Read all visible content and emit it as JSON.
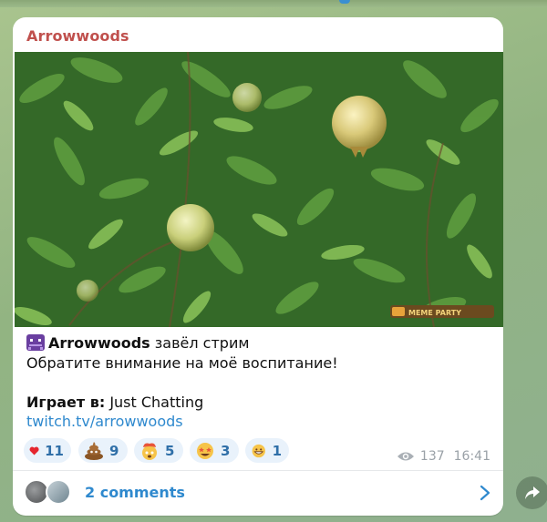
{
  "post": {
    "sender_name": "Arrowwoods",
    "stream_line": {
      "channel": "Arrowwoods",
      "action": "завёл стрим"
    },
    "message": "Обратите внимание на моё воспитание!",
    "playing": {
      "label": "Играет в:",
      "value": "Just Chatting"
    },
    "link": "twitch.tv/arrowwoods",
    "photo_badge": "MEME PARTY"
  },
  "reactions": [
    {
      "emoji": "heart-icon",
      "count": "11"
    },
    {
      "emoji": "pile-of-poo-icon",
      "count": "9"
    },
    {
      "emoji": "exploding-head-icon",
      "count": "5"
    },
    {
      "emoji": "star-struck-icon",
      "count": "3"
    },
    {
      "emoji": "grinning-face-icon",
      "count": "1"
    }
  ],
  "meta": {
    "views": "137",
    "time": "16:41"
  },
  "comments": {
    "label": "2 comments"
  },
  "colors": {
    "sender": "#c0504d",
    "link": "#2f89ce",
    "reaction_bg": "#e9f2fb"
  }
}
